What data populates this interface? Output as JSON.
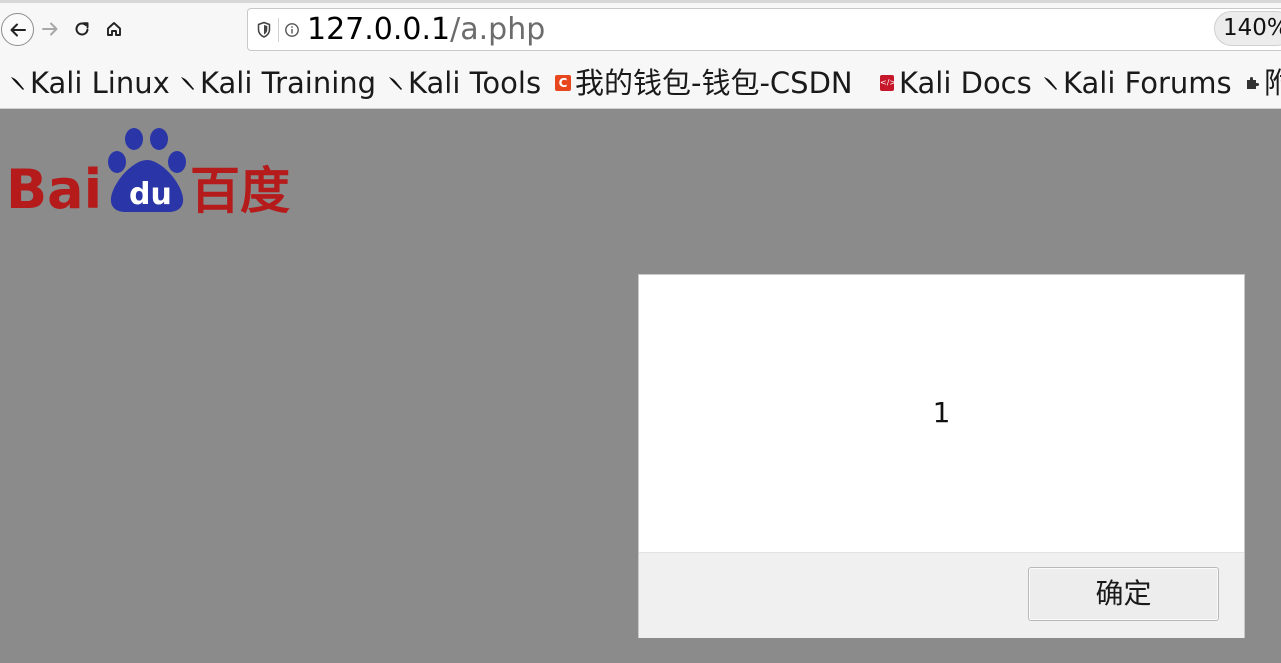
{
  "toolbar": {
    "url_host": "127.0.0.1",
    "url_path": "/a.php",
    "zoom": "140%"
  },
  "icons": {
    "back": "arrow-left-icon",
    "forward": "arrow-right-icon",
    "reload": "reload-icon",
    "home": "home-icon",
    "shield": "shield-icon",
    "info": "info-icon",
    "kali": "kali-dragon-icon",
    "csdn": "csdn-icon",
    "docs": "kali-docs-icon",
    "extension": "puzzle-icon"
  },
  "bookmarks": [
    {
      "label": "Kali Linux"
    },
    {
      "label": "Kali Training"
    },
    {
      "label": "Kali Tools"
    },
    {
      "label": "我的钱包-钱包-CSDN",
      "icon_letter": "C"
    },
    {
      "label": "Kali Docs"
    },
    {
      "label": "Kali Forums"
    },
    {
      "label": "附"
    }
  ],
  "page": {
    "logo": {
      "text_left": "Bai",
      "text_paw": "du",
      "text_right": "百度"
    },
    "colors": {
      "logo_red": "#b51b1b",
      "logo_blue": "#2a35a8",
      "overlay": "#8b8b8b"
    }
  },
  "dialog": {
    "message": "1",
    "ok_label": "确定"
  }
}
